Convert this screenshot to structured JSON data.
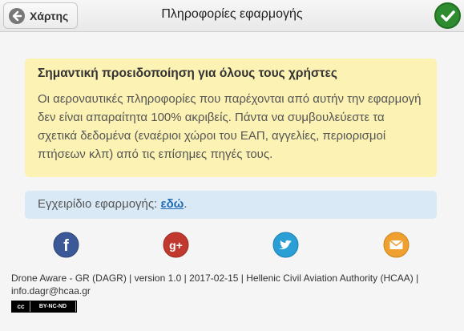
{
  "header": {
    "back_label": "Χάρτης",
    "title": "Πληροφορίες εφαρμογής"
  },
  "warning": {
    "heading": "Σημαντική προειδοποίηση για όλους τους χρήστες",
    "body": "Οι αεροναυτικές πληροφορίες που παρέχονται από αυτήν την εφαρμογή δεν είναι απαραίτητα 100% ακριβείς. Πάντα να συμβουλεύεστε τα σχετικά δεδομένα (εναέριοι χώροι του ΕΑΠ, αγγελίες, περιορισμοί πτήσεων κλπ) από τις επίσημες πηγές τους."
  },
  "manual": {
    "prefix": "Εγχειρίδιο εφαρμογής:",
    "link": "εδώ",
    "suffix": "."
  },
  "social": [
    {
      "name": "facebook-icon",
      "glyph": "f",
      "color": "#3b5998"
    },
    {
      "name": "google-plus-icon",
      "glyph": "g+",
      "color": "#c1382f"
    },
    {
      "name": "twitter-icon",
      "glyph": "",
      "color": "#2a9fd6"
    },
    {
      "name": "email-icon",
      "glyph": "",
      "color": "#f0a030"
    }
  ],
  "footer": {
    "text": "Drone Aware - GR (DAGR) | version 1.0 | 2017-02-15 | Hellenic Civil Aviation Authority (HCAA) | info.dagr@hcaa.gr"
  },
  "license": {
    "left": "cc",
    "right": "BY-NC-ND"
  }
}
